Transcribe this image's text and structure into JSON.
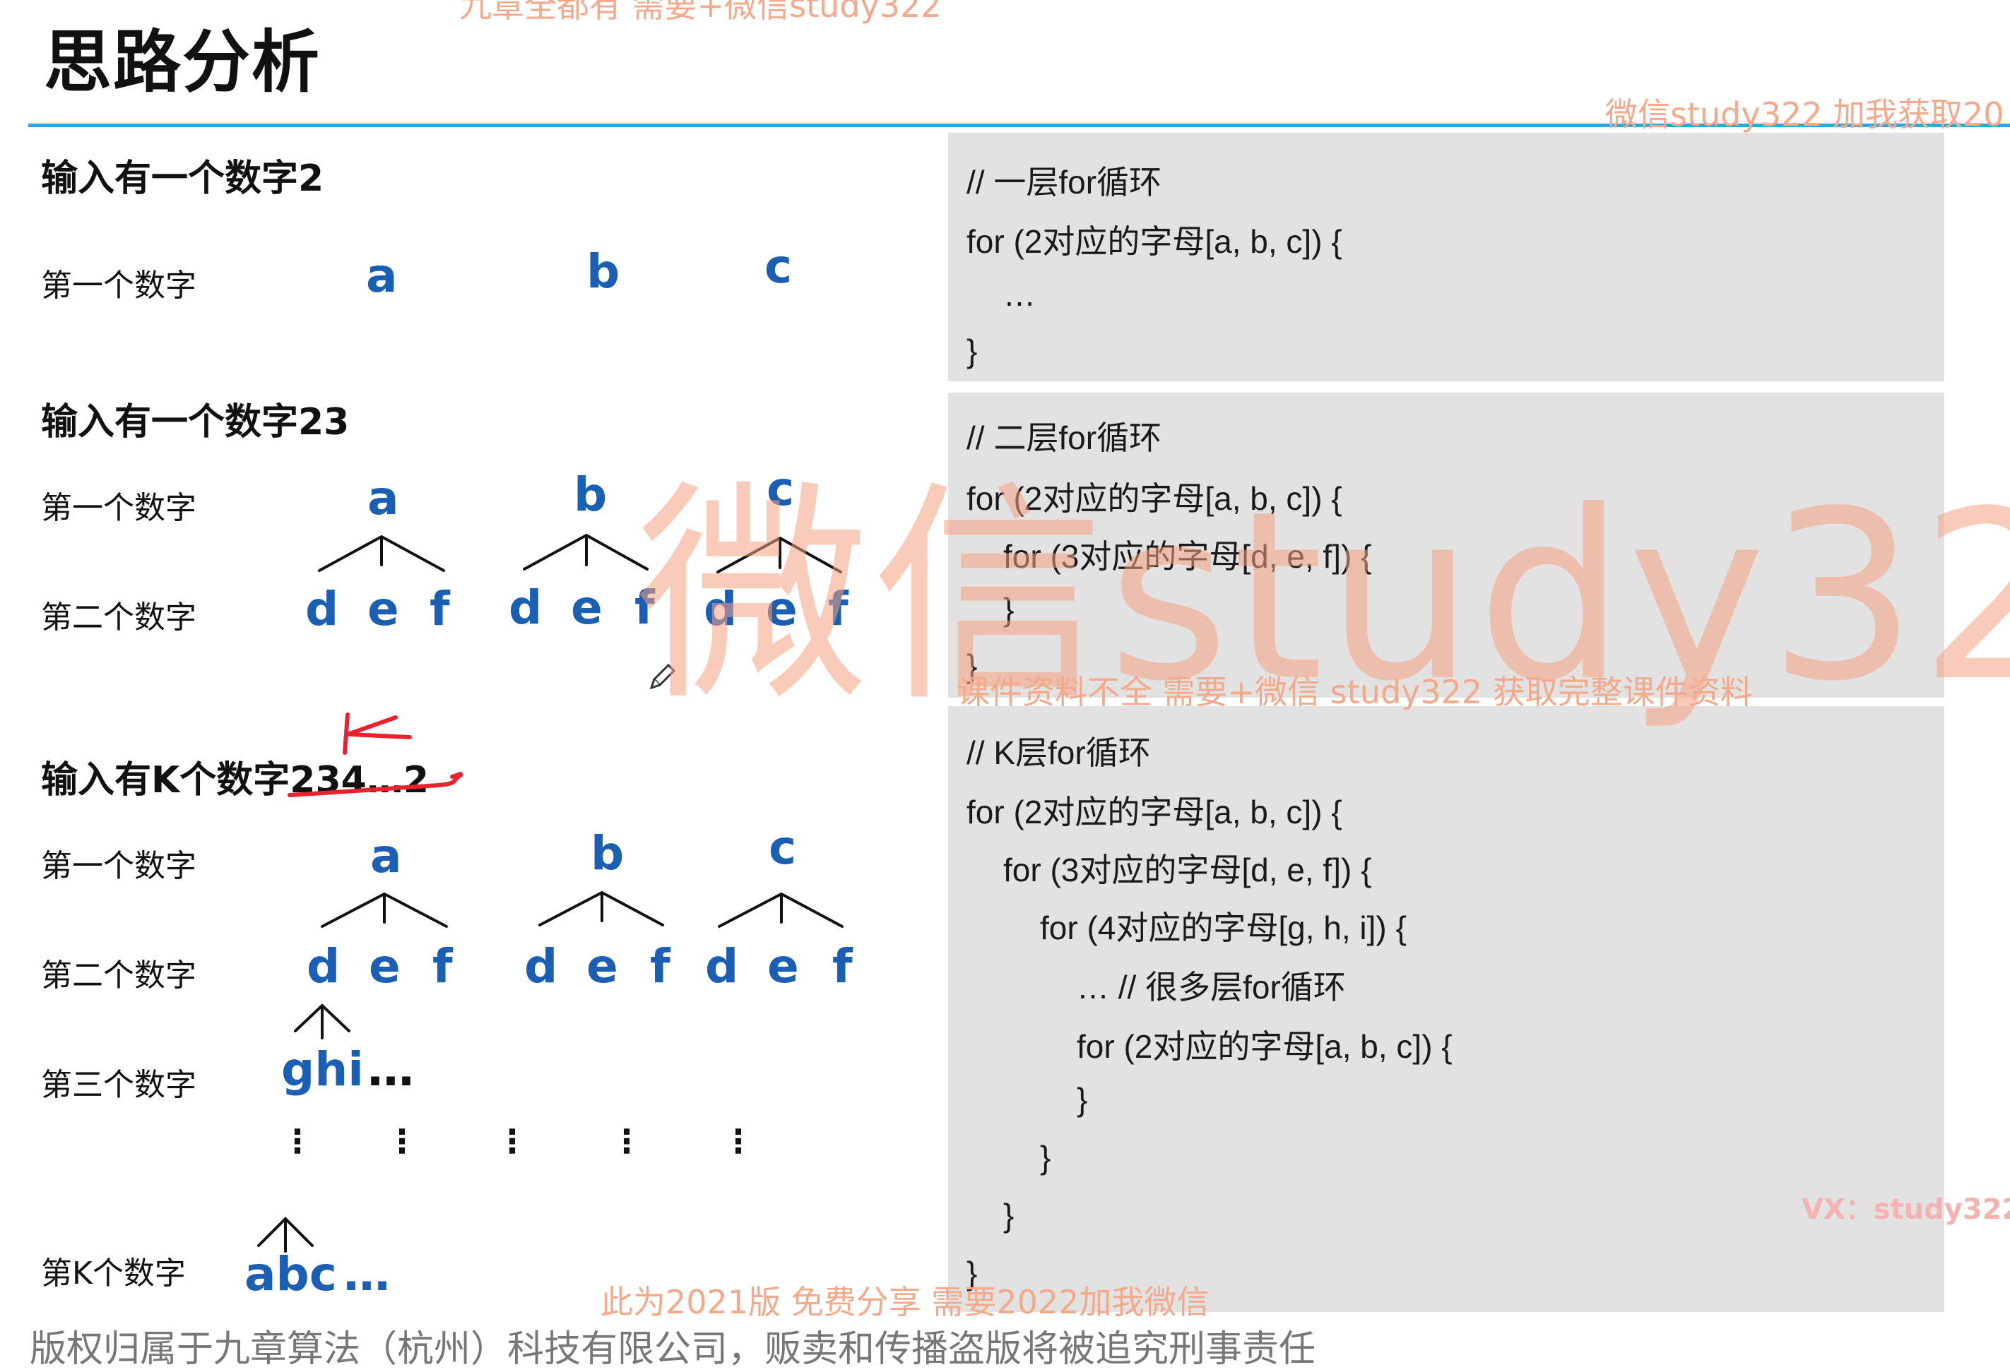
{
  "title": "思路分析",
  "watermarks": {
    "top_center": "九章全都有 需要+微信study322",
    "top_right": "微信study322 加我获取20",
    "big": "微信study32",
    "middle": "课件资料不全 需要+微信 study322 获取完整课件资料",
    "vx": "VX：study322",
    "bottom": "此为2021版 免费分享 需要2022加我微信"
  },
  "copyright": "版权归属于九章算法（杭州）科技有限公司，贩卖和传播盗版将被追究刑事责任",
  "section1": {
    "heading": "输入有一个数字2",
    "row1_label": "第一个数字",
    "row1_letters": [
      "a",
      "b",
      "c"
    ]
  },
  "section2": {
    "heading": "输入有一个数字23",
    "row1_label": "第一个数字",
    "row1_letters": [
      "a",
      "b",
      "c"
    ],
    "row2_label": "第二个数字",
    "row2_letters": [
      "d",
      "e",
      "f",
      "d",
      "e",
      "f",
      "d",
      "e",
      "f"
    ]
  },
  "section3": {
    "heading": "输入有K个数字234…2",
    "row1_label": "第一个数字",
    "row1_letters": [
      "a",
      "b",
      "c"
    ],
    "row2_label": "第二个数字",
    "row2_letters": [
      "d",
      "e",
      "f",
      "d",
      "e",
      "f",
      "d",
      "e",
      "f"
    ],
    "row3_label": "第三个数字",
    "row3_text": "ghi",
    "row3_ellipsis": "…",
    "rowk_label": "第K个数字",
    "rowk_text": "abc",
    "rowk_ellipsis": "…",
    "vdots": "⋮"
  },
  "code1": {
    "lines": [
      "// 一层for循环",
      "for (2对应的字母[a, b, c]) {",
      "…",
      "}"
    ]
  },
  "code2": {
    "lines": [
      "// 二层for循环",
      "for (2对应的字母[a, b, c]) {",
      "for (3对应的字母[d, e, f]) {",
      "}",
      "}"
    ]
  },
  "code3": {
    "lines": [
      "// K层for循环",
      "for (2对应的字母[a, b, c]) {",
      "for (3对应的字母[d, e, f]) {",
      "for (4对应的字母[g, h, i]) {",
      "… // 很多层for循环",
      "for (2对应的字母[a, b, c]) {",
      "}",
      "}",
      "}",
      "}"
    ]
  },
  "colors": {
    "accent_rule": "#29a9e0",
    "letter_blue": "#1a5fb4",
    "annotation_red": "#e8232e",
    "code_bg": "#e2e2e2",
    "watermark": "#f4a98a"
  }
}
